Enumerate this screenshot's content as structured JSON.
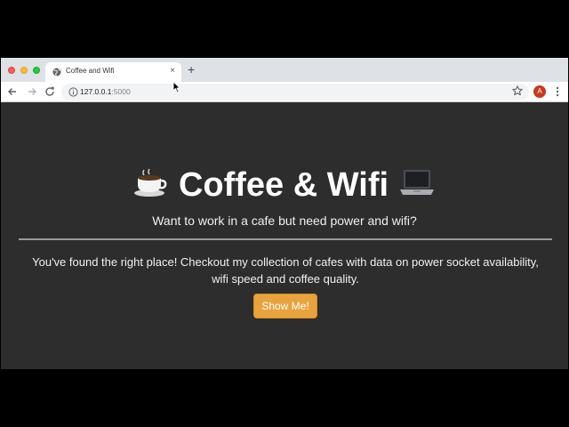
{
  "browser": {
    "tab": {
      "title": "Coffee and Wifi",
      "close_glyph": "×"
    },
    "new_tab_glyph": "+",
    "address_bar": {
      "host": "127.0.0.1",
      "port": ":5000"
    },
    "profile_initial": "A",
    "icons": [
      "globe-icon",
      "back-arrow-icon",
      "forward-arrow-icon",
      "reload-icon",
      "info-icon",
      "star-icon",
      "kebab-menu-icon"
    ]
  },
  "page": {
    "hero": {
      "coffee_emoji": "☕",
      "title": "Coffee & Wifi",
      "laptop_emoji": "💻"
    },
    "tagline": "Want to work in a cafe but need power and wifi?",
    "lead": "You've found the right place! Checkout my collection of cafes with data on power socket availability, wifi speed and coffee quality.",
    "cta_label": "Show Me!"
  },
  "colors": {
    "page_background": "#2d2d2d",
    "cta_background": "#e8a33d",
    "avatar_background": "#c9391d"
  }
}
